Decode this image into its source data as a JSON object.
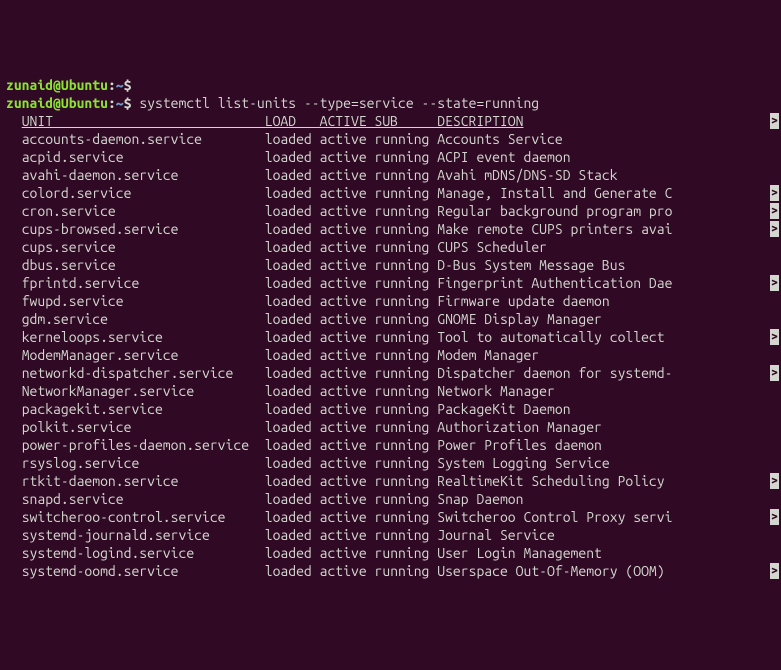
{
  "prompt": {
    "user": "zunaid",
    "at": "@",
    "host": "Ubuntu",
    "colon": ":",
    "path": "~",
    "sigil": "$"
  },
  "command": "systemctl list-units --type=service --state=running",
  "header": {
    "unit": "UNIT",
    "load": "LOAD",
    "active": "ACTIVE",
    "sub": "SUB",
    "description": "DESCRIPTION"
  },
  "cont_glyph": ">",
  "col_widths": {
    "unit": 31,
    "load": 7,
    "active": 7,
    "sub": 8
  },
  "rows": [
    {
      "unit": "accounts-daemon.service",
      "load": "loaded",
      "active": "active",
      "sub": "running",
      "desc": "Accounts Service",
      "cont": false
    },
    {
      "unit": "acpid.service",
      "load": "loaded",
      "active": "active",
      "sub": "running",
      "desc": "ACPI event daemon",
      "cont": false
    },
    {
      "unit": "avahi-daemon.service",
      "load": "loaded",
      "active": "active",
      "sub": "running",
      "desc": "Avahi mDNS/DNS-SD Stack",
      "cont": false
    },
    {
      "unit": "colord.service",
      "load": "loaded",
      "active": "active",
      "sub": "running",
      "desc": "Manage, Install and Generate C",
      "cont": true
    },
    {
      "unit": "cron.service",
      "load": "loaded",
      "active": "active",
      "sub": "running",
      "desc": "Regular background program pro",
      "cont": true
    },
    {
      "unit": "cups-browsed.service",
      "load": "loaded",
      "active": "active",
      "sub": "running",
      "desc": "Make remote CUPS printers avai",
      "cont": true
    },
    {
      "unit": "cups.service",
      "load": "loaded",
      "active": "active",
      "sub": "running",
      "desc": "CUPS Scheduler",
      "cont": false
    },
    {
      "unit": "dbus.service",
      "load": "loaded",
      "active": "active",
      "sub": "running",
      "desc": "D-Bus System Message Bus",
      "cont": false
    },
    {
      "unit": "fprintd.service",
      "load": "loaded",
      "active": "active",
      "sub": "running",
      "desc": "Fingerprint Authentication Dae",
      "cont": true
    },
    {
      "unit": "fwupd.service",
      "load": "loaded",
      "active": "active",
      "sub": "running",
      "desc": "Firmware update daemon",
      "cont": false
    },
    {
      "unit": "gdm.service",
      "load": "loaded",
      "active": "active",
      "sub": "running",
      "desc": "GNOME Display Manager",
      "cont": false
    },
    {
      "unit": "kerneloops.service",
      "load": "loaded",
      "active": "active",
      "sub": "running",
      "desc": "Tool to automatically collect ",
      "cont": true
    },
    {
      "unit": "ModemManager.service",
      "load": "loaded",
      "active": "active",
      "sub": "running",
      "desc": "Modem Manager",
      "cont": false
    },
    {
      "unit": "networkd-dispatcher.service",
      "load": "loaded",
      "active": "active",
      "sub": "running",
      "desc": "Dispatcher daemon for systemd-",
      "cont": true
    },
    {
      "unit": "NetworkManager.service",
      "load": "loaded",
      "active": "active",
      "sub": "running",
      "desc": "Network Manager",
      "cont": false
    },
    {
      "unit": "packagekit.service",
      "load": "loaded",
      "active": "active",
      "sub": "running",
      "desc": "PackageKit Daemon",
      "cont": false
    },
    {
      "unit": "polkit.service",
      "load": "loaded",
      "active": "active",
      "sub": "running",
      "desc": "Authorization Manager",
      "cont": false
    },
    {
      "unit": "power-profiles-daemon.service",
      "load": "loaded",
      "active": "active",
      "sub": "running",
      "desc": "Power Profiles daemon",
      "cont": false
    },
    {
      "unit": "rsyslog.service",
      "load": "loaded",
      "active": "active",
      "sub": "running",
      "desc": "System Logging Service",
      "cont": false
    },
    {
      "unit": "rtkit-daemon.service",
      "load": "loaded",
      "active": "active",
      "sub": "running",
      "desc": "RealtimeKit Scheduling Policy ",
      "cont": true
    },
    {
      "unit": "snapd.service",
      "load": "loaded",
      "active": "active",
      "sub": "running",
      "desc": "Snap Daemon",
      "cont": false
    },
    {
      "unit": "switcheroo-control.service",
      "load": "loaded",
      "active": "active",
      "sub": "running",
      "desc": "Switcheroo Control Proxy servi",
      "cont": true
    },
    {
      "unit": "systemd-journald.service",
      "load": "loaded",
      "active": "active",
      "sub": "running",
      "desc": "Journal Service",
      "cont": false
    },
    {
      "unit": "systemd-logind.service",
      "load": "loaded",
      "active": "active",
      "sub": "running",
      "desc": "User Login Management",
      "cont": false
    },
    {
      "unit": "systemd-oomd.service",
      "load": "loaded",
      "active": "active",
      "sub": "running",
      "desc": "Userspace Out-Of-Memory (OOM) ",
      "cont": true
    }
  ]
}
